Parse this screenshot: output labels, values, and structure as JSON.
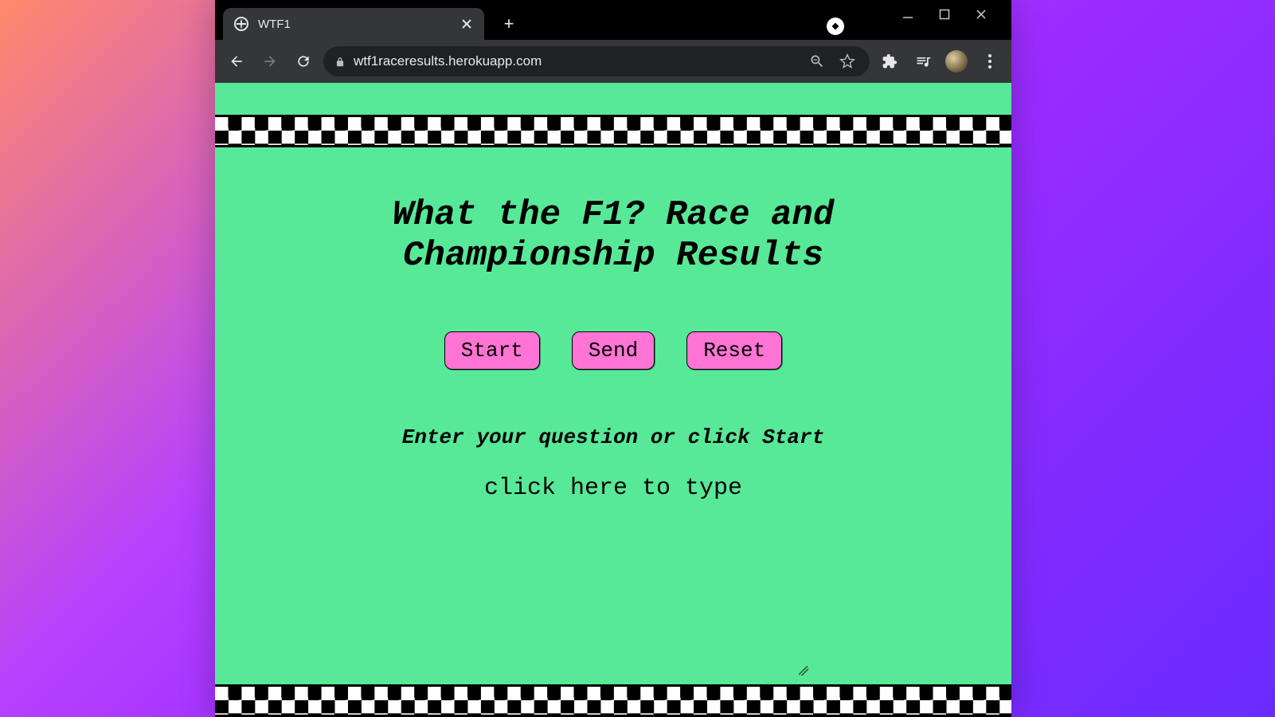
{
  "browser": {
    "tab": {
      "title": "WTF1"
    },
    "newtab_glyph": "+",
    "address": {
      "url_text": "wtf1raceresults.herokuapp.com"
    }
  },
  "page": {
    "title": "What the F1? Race and Championship Results",
    "buttons": {
      "start": "Start",
      "send": "Send",
      "reset": "Reset"
    },
    "prompt": "Enter your question or click Start",
    "textarea_placeholder": "click here to type"
  },
  "colors": {
    "page_bg": "#57e998",
    "button_bg": "#ff74d4"
  }
}
